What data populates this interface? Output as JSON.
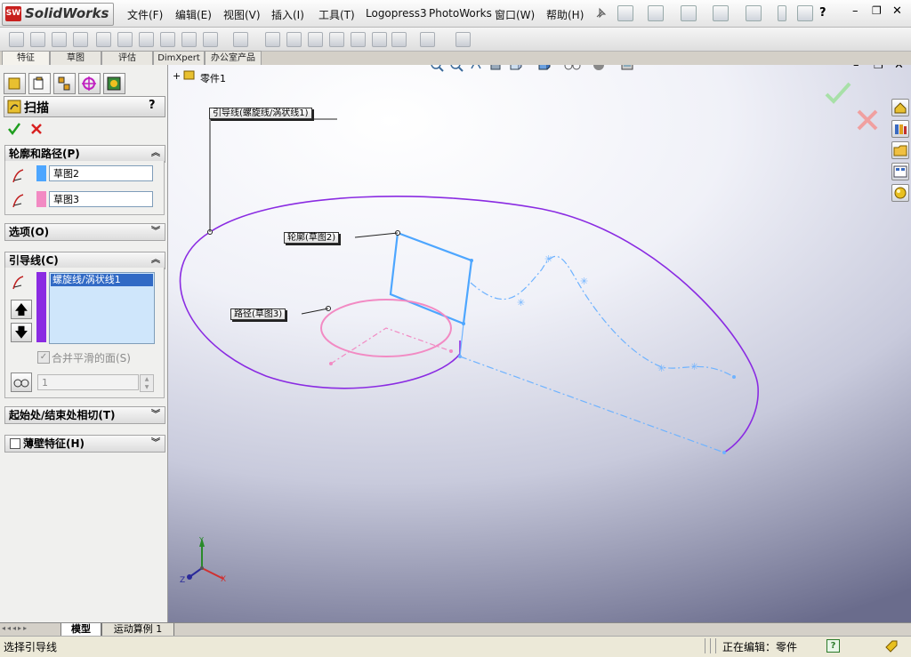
{
  "app": {
    "logo_badge": "SW",
    "logo_text": "SolidWorks"
  },
  "menu": [
    {
      "label": "文件(F)"
    },
    {
      "label": "编辑(E)"
    },
    {
      "label": "视图(V)"
    },
    {
      "label": "插入(I)"
    },
    {
      "label": "工具(T)"
    },
    {
      "label": "Logopress3"
    },
    {
      "label": "PhotoWorks"
    },
    {
      "label": "窗口(W)"
    },
    {
      "label": "帮助(H)"
    }
  ],
  "left_tabs": [
    "特征",
    "草图",
    "评估",
    "DimXpert",
    "办公室产品"
  ],
  "feature": {
    "title": "扫描",
    "help": "?"
  },
  "sections": {
    "profile_path": {
      "label": "轮廓和路径(P)",
      "profile_value": "草图2",
      "path_value": "草图3",
      "profile_color": "#4da6ff",
      "path_color": "#f28ac3"
    },
    "options": {
      "label": "选项(O)"
    },
    "guides": {
      "label": "引导线(C)",
      "list_item": "螺旋线/涡状线1",
      "merge_smooth": "合并平滑的面(S)",
      "spin_value": "1",
      "guide_color": "#8a2be2"
    },
    "tangency": {
      "label": "起始处/结束处相切(T)"
    },
    "thin": {
      "label": "薄壁特征(H)"
    }
  },
  "tree": {
    "part": "零件1"
  },
  "callouts": {
    "guide": "引导线(螺旋线/涡状线1)",
    "profile": "轮廓(草图2)",
    "path": "路径(草图3)"
  },
  "triad": {
    "x": "X",
    "y": "Y",
    "z": "Z"
  },
  "bottom_tabs": {
    "model": "模型",
    "motion": "运动算例 1"
  },
  "status": {
    "prompt": "选择引导线",
    "editing": "正在编辑：零件",
    "help_icon": "?"
  },
  "colors": {
    "guide_curve": "#8a2be2",
    "profile": "#4da6ff",
    "path": "#f28ac3",
    "dashed": "#6fb3ff",
    "ok": "#1f9e1f",
    "cancel": "#d82020"
  }
}
